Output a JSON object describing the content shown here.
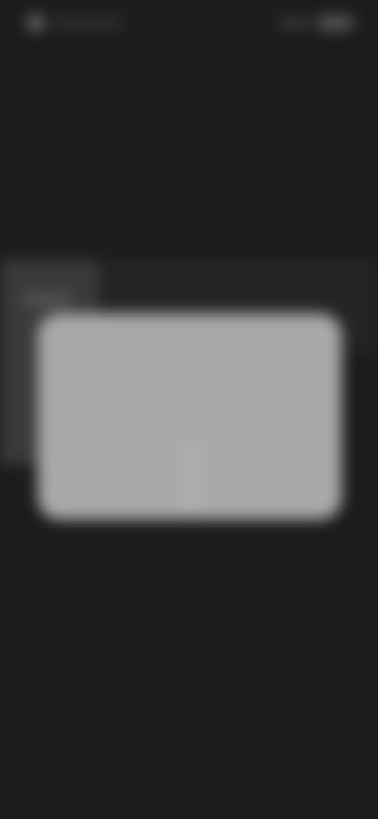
{
  "status_bar": {
    "left_icon": "app-notification-icon",
    "right_icons": [
      "signal-icon",
      "battery-icon"
    ]
  },
  "dialog": {
    "title": "",
    "body": "",
    "negative_button": "",
    "positive_button": ""
  },
  "colors": {
    "background": "#1c1c1c",
    "dialog": "#a9a9a9"
  }
}
